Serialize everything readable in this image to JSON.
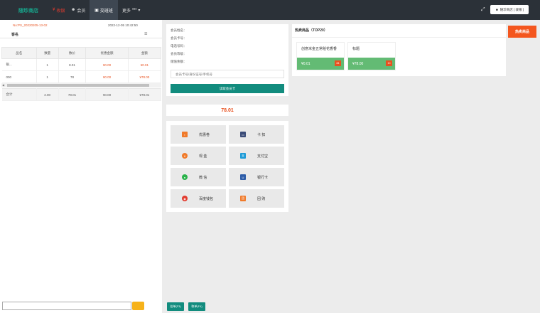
{
  "header": {
    "logo": "随珍商店",
    "nav_checkout": "收银",
    "nav_member": "会员",
    "nav_shift": "交班班",
    "nav_more": "更多",
    "user_label": "随珍商店 [ 收银 ]"
  },
  "order": {
    "number": "No:PS_20220205-13-02",
    "time": "2022-12-05 10:42:50",
    "customer_label": "客名"
  },
  "cart": {
    "headers": [
      "品名",
      "数量",
      "数价",
      "优惠金额",
      "金额"
    ],
    "rows": [
      {
        "name": "银...",
        "qty": "1",
        "price": "8.01",
        "discount": "¥0.00",
        "amount": "¥0.01"
      },
      {
        "name": "000",
        "qty": "1",
        "price": "78",
        "discount": "¥0.00",
        "amount": "¥78.00"
      }
    ],
    "total": {
      "label": "合计",
      "qty": "2.00",
      "price": "78.01",
      "discount": "¥0.00",
      "amount": "¥78.01"
    }
  },
  "member": {
    "fields": [
      "会员姓名：",
      "会员卡号：",
      "电话号码：",
      "会员等级：",
      "储值余额："
    ],
    "placeholder": "会员卡号/身份证号/手机号",
    "query_label": "读取会员卡"
  },
  "amount_due": "78.01",
  "payments": [
    {
      "label": "优惠卷",
      "icon": "coupon-icon",
      "color": "#f07a2a"
    },
    {
      "label": "卡 扣",
      "icon": "card-icon",
      "color": "#3b4c78"
    },
    {
      "label": "现 金",
      "icon": "cash-icon",
      "color": "#f07a2a"
    },
    {
      "label": "支付宝",
      "icon": "alipay-icon",
      "color": "#1d9bd7"
    },
    {
      "label": "微 信",
      "icon": "wechat-icon",
      "color": "#2ab34a"
    },
    {
      "label": "银行卡",
      "icon": "unionpay-icon",
      "color": "#2d5ca8"
    },
    {
      "label": "百度钱包",
      "icon": "baidu-wallet-icon",
      "color": "#e23b2e"
    },
    {
      "label": "团 购",
      "icon": "group-buy-icon",
      "color": "#f07a2a"
    }
  ],
  "hot": {
    "title": "热卖商品（TOP20）",
    "tab_label": "热卖商品",
    "products": [
      {
        "name": "创意米金五常稻花香香",
        "price": "¥0.01",
        "stock": "84"
      },
      {
        "name": "标题",
        "price": "¥78.00",
        "stock": "10"
      }
    ]
  },
  "footer": {
    "hang_label": "挂单(F3)",
    "fetch_label": "取单(F4)"
  }
}
